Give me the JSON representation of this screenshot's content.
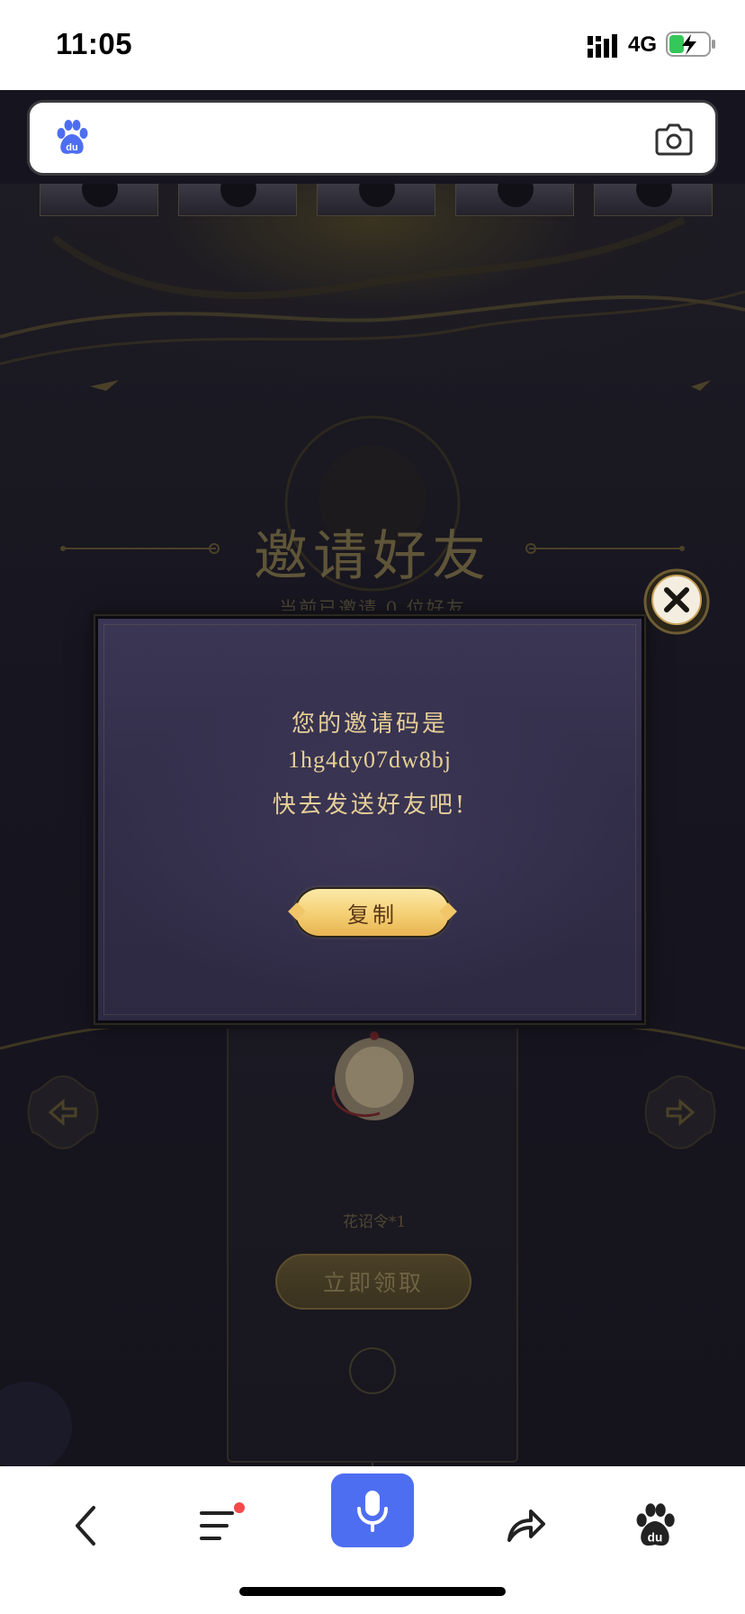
{
  "status_bar": {
    "time": "11:05",
    "network": "4G",
    "icons": [
      "signal-icon",
      "battery-charging-icon"
    ]
  },
  "search_bar": {
    "icons": [
      "baidu-logo-icon",
      "camera-icon"
    ],
    "brand_color": "#4e6ef2"
  },
  "game": {
    "invite_title": "邀请好友",
    "invite_count_text": "当前已邀请 0 位好友",
    "reward_item_name": "花诏令*1",
    "claim_label": "立即领取"
  },
  "modal": {
    "line1": "您的邀请码是",
    "invite_code": "1hg4dy07dw8bj",
    "line3": "快去发送好友吧!",
    "copy_label": "复制",
    "close_icon": "close-icon"
  },
  "toolbar": {
    "items": [
      "back-icon",
      "menu-icon",
      "voice-icon",
      "share-icon",
      "baidu-paw-icon"
    ],
    "voice_color": "#4e6ef2",
    "menu_badge_color": "#f24a4a"
  }
}
